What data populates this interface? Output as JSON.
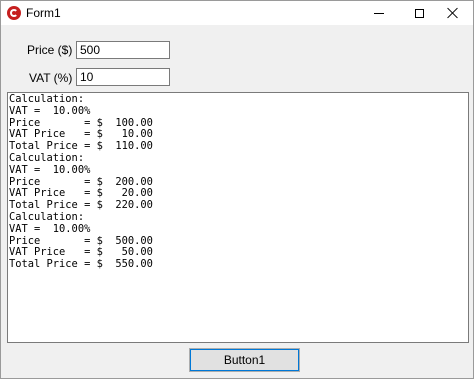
{
  "window": {
    "title": "Form1",
    "controls": [
      "minimize",
      "maximize",
      "close"
    ]
  },
  "form": {
    "price_label": "Price ($)",
    "price_value": "500",
    "vat_label": "VAT (%)",
    "vat_value": "10"
  },
  "output": {
    "lines": [
      "Calculation:",
      "VAT =  10.00%",
      "Price       = $  100.00",
      "VAT Price   = $   10.00",
      "Total Price = $  110.00",
      "Calculation:",
      "VAT =  10.00%",
      "Price       = $  200.00",
      "VAT Price   = $   20.00",
      "Total Price = $  220.00",
      "Calculation:",
      "VAT =  10.00%",
      "Price       = $  500.00",
      "VAT Price   = $   50.00",
      "Total Price = $  550.00"
    ]
  },
  "button": {
    "label": "Button1"
  },
  "icons": {
    "app": "app-icon",
    "minimize": "minimize-icon",
    "maximize": "maximize-icon",
    "close": "close-icon"
  },
  "colors": {
    "app_icon": "#c62020",
    "focus_outline": "#0078d7"
  }
}
